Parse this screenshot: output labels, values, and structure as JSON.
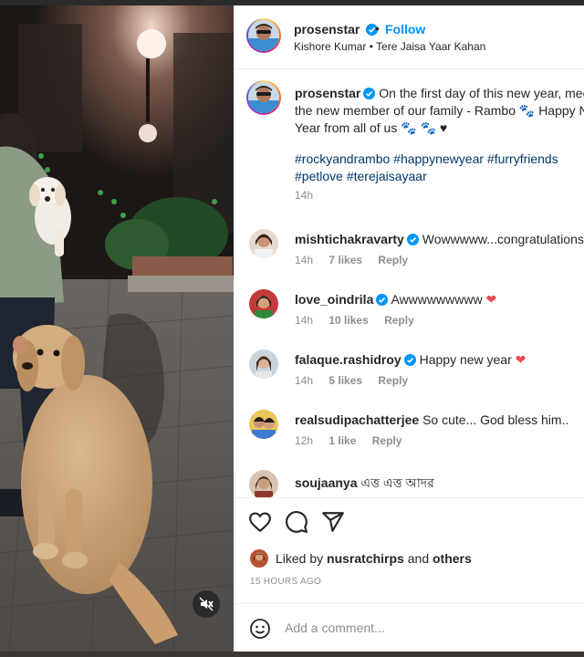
{
  "post": {
    "username": "prosenstar",
    "follow_label": "Follow",
    "header_dot": "•",
    "audio": "Kishore Kumar • Tere Jaisa Yaar Kahan"
  },
  "caption": {
    "username": "prosenstar",
    "text": "On the first day of this new year, meet the new member of our family - Rambo 🐾 Happy New Year from all of us 🐾 🐾 ♥",
    "hashtags": "#rockyandrambo #happynewyear #furryfriends #petlove #terejaisayaar",
    "time": "14h"
  },
  "comments": [
    {
      "username": "mishtichakravarty",
      "verified": true,
      "text": "Wowwwww...congratulations ❤",
      "time": "14h",
      "likes": "7 likes",
      "reply": "Reply"
    },
    {
      "username": "love_oindrila",
      "verified": true,
      "text": "Awwwwwwwww ❤",
      "time": "14h",
      "likes": "10 likes",
      "reply": "Reply"
    },
    {
      "username": "falaque.rashidroy",
      "verified": true,
      "text": "Happy new year ❤",
      "time": "14h",
      "likes": "5 likes",
      "reply": "Reply"
    },
    {
      "username": "realsudipachatterjee",
      "verified": false,
      "text": "So cute... God bless him..",
      "time": "12h",
      "likes": "1 like",
      "reply": "Reply"
    },
    {
      "username": "soujaanya",
      "verified": false,
      "text": "এত্ত এত্ত আদর",
      "time": "",
      "likes": "",
      "reply": ""
    }
  ],
  "actions": {
    "liked_prefix": "Liked by",
    "liked_user": "nusratchirps",
    "liked_and": "and",
    "liked_others": "others",
    "timestamp": "15 HOURS AGO"
  },
  "composer": {
    "placeholder": "Add a comment..."
  },
  "icons": {
    "verified": "verified-badge-icon",
    "like": "heart-outline-icon",
    "comment": "speech-bubble-icon",
    "share": "paper-plane-icon",
    "emoji": "smiley-icon",
    "mute": "speaker-muted-icon"
  },
  "colors": {
    "link_blue": "#0095f6",
    "hashtag_blue": "#00376b",
    "verified_blue": "#0095f6",
    "heart_red": "#ed4956",
    "muted_text": "#8e8e8e"
  }
}
